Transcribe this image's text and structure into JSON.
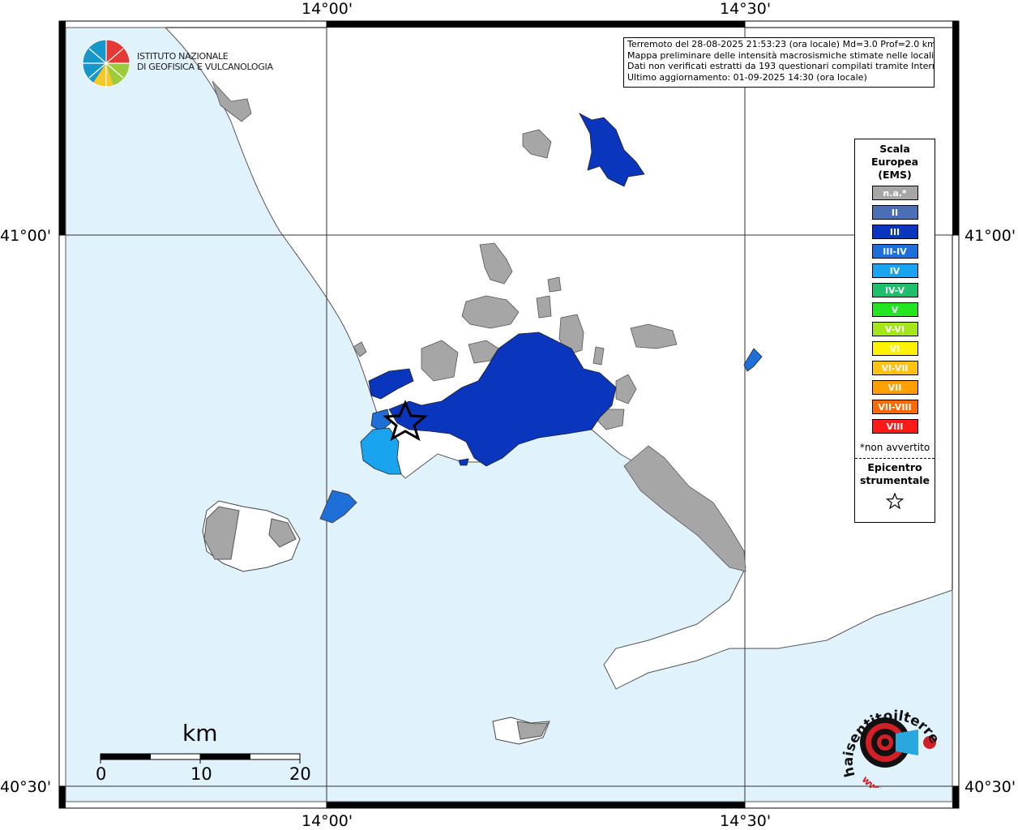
{
  "map": {
    "grid_labels": {
      "lon_1": "14°00'",
      "lon_2": "14°30'",
      "lat_1": "41°00'",
      "lat_2": "40°30'"
    },
    "colors": {
      "sea": "#e0f2fc",
      "land": "#ffffff",
      "na_gray": "#a6a6a6",
      "intensity_III": "#0a35bd",
      "intensity_III_IV": "#1f6fd9",
      "intensity_IV": "#1aa3ee"
    },
    "epicenter_marker": "star-icon"
  },
  "info": {
    "line1": "Terremoto del 28-08-2025 21:53:23 (ora locale) Md=3.0 Prof=2.0 km",
    "line2": "Mappa preliminare delle intensità macrosismiche stimate nelle località",
    "line3": "Dati non verificati estratti da 193 questionari compilati tramite Internet.",
    "line4": "Ultimo aggiornamento: 01-09-2025 14:30 (ora locale)"
  },
  "logo": {
    "line1": "ISTITUTO NAZIONALE",
    "line2": "DI GEOFISICA E VULCANOLOGIA"
  },
  "legend": {
    "title_1": "Scala",
    "title_2": "Europea",
    "title_3": "(EMS)",
    "items": [
      {
        "label": "n.a.*",
        "color": "#a6a6a6"
      },
      {
        "label": "II",
        "color": "#4a6fb5"
      },
      {
        "label": "III",
        "color": "#0a35bd"
      },
      {
        "label": "III-IV",
        "color": "#1f6fd9"
      },
      {
        "label": "IV",
        "color": "#1aa3ee"
      },
      {
        "label": "IV-V",
        "color": "#1dbf6b"
      },
      {
        "label": "V",
        "color": "#22e622"
      },
      {
        "label": "V-VI",
        "color": "#a3e619"
      },
      {
        "label": "VI",
        "color": "#fff200"
      },
      {
        "label": "VI-VII",
        "color": "#ffc20e"
      },
      {
        "label": "VII",
        "color": "#ff9f00"
      },
      {
        "label": "VII-VIII",
        "color": "#ff6a00"
      },
      {
        "label": "VIII",
        "color": "#ff1a1a"
      }
    ],
    "note": "*non avvertito",
    "epicenter_1": "Epicentro",
    "epicenter_2": "strumentale"
  },
  "scalebar": {
    "unit": "km",
    "ticks": [
      "0",
      "10",
      "20"
    ]
  },
  "site_logo": {
    "text": "haisentitoilterremoto.it",
    "prefix": "www."
  }
}
